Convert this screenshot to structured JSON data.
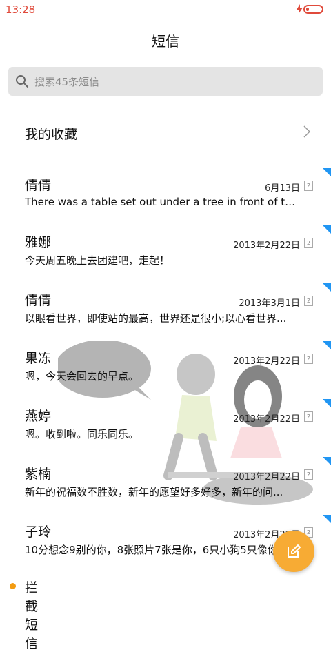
{
  "status_bar": {
    "time": "13:28"
  },
  "header": {
    "title": "短信"
  },
  "search": {
    "placeholder": "搜索45条短信"
  },
  "favorites": {
    "label": "我的收藏"
  },
  "threads": [
    {
      "name": "倩倩",
      "date": "6月13日",
      "sim": "2",
      "message": "There was a table set out under a tree in front of the..."
    },
    {
      "name": "雅娜",
      "date": "2013年2月22日",
      "sim": "2",
      "message": "今天周五晚上去团建吧，走起！"
    },
    {
      "name": "倩倩",
      "date": "2013年3月1日",
      "sim": "2",
      "message": "以眼看世界，即使站的最高，世界还是很小;以心看世界..."
    },
    {
      "name": "果冻",
      "date": "2013年2月22日",
      "sim": "2",
      "message": "嗯，今天会回去的早点。"
    },
    {
      "name": "燕婷",
      "date": "2013年2月22日",
      "sim": "2",
      "message": "嗯。收到啦。同乐同乐。"
    },
    {
      "name": "紫楠",
      "date": "2013年2月22日",
      "sim": "2",
      "message": "新年的祝福数不胜数，新年的愿望好多好多，新年的问..."
    },
    {
      "name": "子玲",
      "date": "2013年2月22日",
      "sim": "2",
      "message": "10分想念9别的你，8张照片7张是你，6只小狗5只像你..."
    }
  ],
  "blocked": {
    "label": "拦截短信"
  },
  "colors": {
    "accent": "#f7ab34",
    "unread_flag": "#2196f3",
    "status_red": "#e04a3b"
  },
  "icons": {
    "search": "search-icon",
    "chevron": "chevron-right-icon",
    "compose": "compose-icon",
    "charging": "charging-icon",
    "battery": "battery-icon"
  }
}
